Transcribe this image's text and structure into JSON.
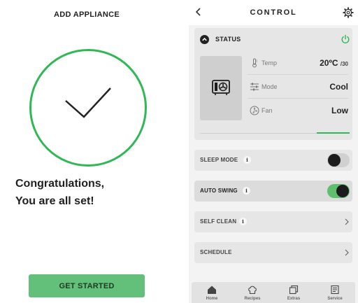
{
  "add_appliance": {
    "title": "ADD APPLIANCE",
    "congrats_line1": "Congratulations,",
    "congrats_line2": "You are all set!",
    "get_started_label": "GET STARTED",
    "success_color": "#2fb855",
    "button_color": "#63c07a"
  },
  "control": {
    "title": "CONTROL",
    "back_icon": "chevron-left-icon",
    "settings_icon": "gear-icon",
    "status": {
      "label": "STATUS",
      "power_icon": "power-icon",
      "power_color": "#2fb855",
      "device_icon": "air-conditioner-icon",
      "temp": {
        "label": "Temp",
        "value": "20ºC",
        "unit": "/30"
      },
      "mode": {
        "label": "Mode",
        "value": "Cool"
      },
      "fan": {
        "label": "Fan",
        "value": "Low"
      }
    },
    "sleep_mode": {
      "label": "SLEEP MODE",
      "info": "i",
      "enabled": false
    },
    "auto_swing": {
      "label": "AUTO SWING",
      "info": "i",
      "enabled": true
    },
    "self_clean": {
      "label": "SELF CLEAN",
      "info": "i"
    },
    "schedule": {
      "label": "SCHEDULE"
    },
    "toggle_on_color": "#5fbf6e"
  },
  "tabbar": {
    "items": [
      {
        "label": "Home",
        "icon": "home-icon"
      },
      {
        "label": "Recipes",
        "icon": "chef-hat-icon"
      },
      {
        "label": "Extras",
        "icon": "extras-icon"
      },
      {
        "label": "Service",
        "icon": "service-icon"
      }
    ]
  }
}
